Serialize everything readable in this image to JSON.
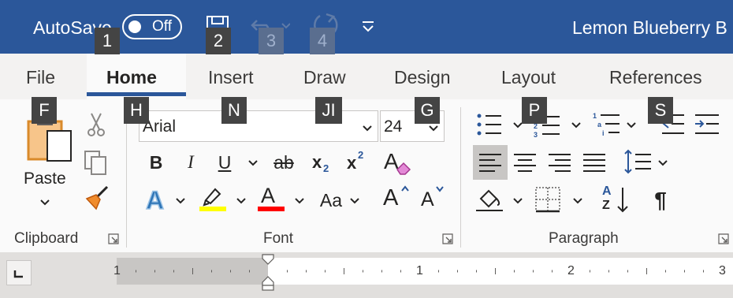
{
  "titlebar": {
    "autosave_label": "AutoSave",
    "autosave_state": "Off",
    "document_title": "Lemon Blueberry B",
    "accent_color": "#2b579a"
  },
  "keytips": {
    "autosave": "1",
    "save": "2",
    "undo": "3",
    "redo": "4",
    "file": "F",
    "home": "H",
    "insert": "N",
    "draw": "JI",
    "design": "G",
    "layout": "P",
    "references": "S"
  },
  "tabs": [
    {
      "label": "File",
      "active": false
    },
    {
      "label": "Home",
      "active": true
    },
    {
      "label": "Insert",
      "active": false
    },
    {
      "label": "Draw",
      "active": false
    },
    {
      "label": "Design",
      "active": false
    },
    {
      "label": "Layout",
      "active": false
    },
    {
      "label": "References",
      "active": false
    }
  ],
  "clipboard": {
    "paste_label": "Paste",
    "group_label": "Clipboard",
    "icons": [
      "paste-icon",
      "cut-icon",
      "copy-icon",
      "format-painter-icon"
    ]
  },
  "font": {
    "group_label": "Font",
    "font_name": "Arial",
    "font_size": "24",
    "bold": "B",
    "italic": "I",
    "underline": "U",
    "strikethrough": "ab",
    "subscript": "x",
    "subscript_mark": "2",
    "superscript": "x",
    "superscript_mark": "2",
    "text_effects": "A",
    "font_color_glyph": "A",
    "change_case": "Aa",
    "grow_font": "A",
    "shrink_font": "A",
    "highlight_color": "#ffff00",
    "font_color": "#ff0000"
  },
  "paragraph": {
    "group_label": "Paragraph",
    "icons": [
      "bullets-icon",
      "numbering-icon",
      "multilevel-list-icon",
      "decrease-indent-icon",
      "increase-indent-icon",
      "align-left-icon",
      "center-icon",
      "align-right-icon",
      "justify-icon",
      "line-spacing-icon",
      "shading-icon",
      "borders-icon",
      "sort-icon",
      "show-marks-icon"
    ],
    "sort_top": "A",
    "sort_bottom": "Z",
    "pilcrow": "¶"
  },
  "ruler": {
    "numbers": [
      "1",
      "1",
      "2",
      "3"
    ]
  }
}
